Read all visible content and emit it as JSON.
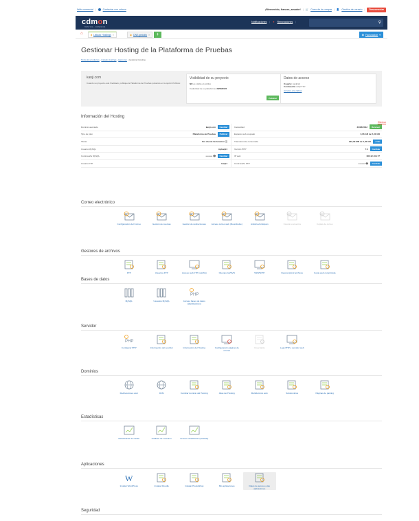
{
  "topbar": {
    "left": [
      "Web comercial",
      "Contactar con cdmon"
    ],
    "greeting": "¡Bienvenido, frances_amador!",
    "cart": "Carro de la compra",
    "user": "Gestión de usuario",
    "logout": "Desconectar"
  },
  "header": {
    "logo": "cdmon",
    "logo_sub": "HOSTING · DOMINIOS",
    "links": [
      "Notificaciones",
      "Renovaciones"
    ]
  },
  "tabs": [
    {
      "label": "Listado Hostings",
      "icon": "chart-icon"
    },
    {
      "label": "DNS gratuito",
      "icon": "dns-icon"
    }
  ],
  "billing": "Facturación",
  "page": {
    "title": "Gestionar Hosting de la Plataforma de Pruebas",
    "breadcrumb": [
      "Todos los productos",
      "Listado Hostings",
      "kanji.com",
      "Gestionar Hosting"
    ]
  },
  "cards": {
    "domain": {
      "title": "kanji.com",
      "text": "Cuando su proyecto esté finalizado, publique la Plataforma de Pruebas pulsando en la opción Publicar."
    },
    "visibility": {
      "title": "Visibilidad de su proyecto",
      "line1_bold": "NO",
      "line1": "es visible al público",
      "line2": "Caducidad de su plataforma:",
      "line2_date": "30/08/2022",
      "button": "Publicar"
    },
    "access": {
      "title": "Datos de acceso",
      "user_label": "Usuario:",
      "user": "kanjiris4",
      "pass_label": "Contraseña:",
      "pass": "A2yl7YKY",
      "link": "Acceder a la cabina"
    }
  },
  "hosting_info": {
    "title": "Información del Hosting",
    "delete": "Eliminar",
    "left": [
      {
        "label": "Dominio asociado",
        "value": "kanji.com",
        "button": "Cambiar"
      },
      {
        "label": "Tipo de plan",
        "value": "Plataforma de Pruebas",
        "button": "Publicar"
      },
      {
        "label": "Titular",
        "value": "Sin cliente facturación ⓘ",
        "button": ""
      },
      {
        "label": "Usuario MySQL",
        "value": "mykanji4",
        "button": ""
      },
      {
        "label": "Contraseña MySQL",
        "value": "•••••••••  👁",
        "button": "Cambiar"
      },
      {
        "label": "Usuario FTP",
        "value": "kanji4",
        "button": ""
      }
    ],
    "right": [
      {
        "label": "Caducidad",
        "value": "30/08/2022",
        "button": "Renovar"
      },
      {
        "label": "Espacio web ocupado",
        "value": "0,06 GB de 5,00 GB",
        "button": ""
      },
      {
        "label": "Transferencia consumida",
        "value": "293,09 MB de 5,00 GB",
        "button": "+ Info"
      },
      {
        "label": "Versión PHP",
        "value": "7.4",
        "button": "Cambiar"
      },
      {
        "label": "IP web",
        "value": "185.42.104.77",
        "button": ""
      },
      {
        "label": "Contraseña FTP",
        "value": "•••••••••  👁",
        "button": "Cambiar"
      }
    ]
  },
  "sections": [
    {
      "title": "Correo electrónico",
      "items": [
        {
          "label": "Configuración del Correo",
          "icon": "mail-gear-icon",
          "enabled": true
        },
        {
          "label": "Gestión de cuentas",
          "icon": "mail-accounts-icon",
          "enabled": true
        },
        {
          "label": "Gestión de redirecciones",
          "icon": "mail-redirect-icon",
          "enabled": true
        },
        {
          "label": "Acceso correo web (Roundcube)",
          "icon": "webmail-icon",
          "enabled": true
        },
        {
          "label": "Antivirus/Antispam",
          "icon": "mail-shield-icon",
          "enabled": true
        },
        {
          "label": "Usuario encuentra",
          "icon": "mail-user-icon",
          "enabled": false
        },
        {
          "label": "Copias de correo",
          "icon": "mail-copy-icon",
          "enabled": false
        }
      ]
    },
    {
      "title": "Gestores de archivos",
      "items": [
        {
          "label": "FTP",
          "icon": "ftp-icon",
          "enabled": true
        },
        {
          "label": "Usuarios FTP",
          "icon": "ftp-users-icon",
          "enabled": true
        },
        {
          "label": "Acceso web FTP (net2ftp)",
          "icon": "web-ftp-icon",
          "enabled": true
        },
        {
          "label": "Clientes Git/SVN",
          "icon": "git-icon",
          "enabled": true
        },
        {
          "label": "SSH/SFTP",
          "icon": "terminal-icon",
          "enabled": true
        },
        {
          "label": "Descomprimir archivos",
          "icon": "unzip-icon",
          "enabled": true
        },
        {
          "label": "Copia web comprimida",
          "icon": "archive-icon",
          "enabled": true
        }
      ]
    },
    {
      "title": "Bases de datos",
      "items": [
        {
          "label": "MySQL",
          "icon": "database-icon",
          "enabled": true
        },
        {
          "label": "Usuarios MySQL",
          "icon": "db-users-icon",
          "enabled": true
        },
        {
          "label": "Acceso bases de datos (phpMyAdmin)",
          "icon": "phpmyadmin-icon",
          "enabled": true
        }
      ]
    },
    {
      "title": "Servidor",
      "items": [
        {
          "label": "Configurar PHP",
          "icon": "php-gear-icon",
          "enabled": true
        },
        {
          "label": "Información del servidor",
          "icon": "server-info-icon",
          "enabled": true
        },
        {
          "label": "Información del Hosting",
          "icon": "hosting-info-icon",
          "enabled": true
        },
        {
          "label": "Configuración páginas de errores",
          "icon": "error-page-icon",
          "enabled": true
        },
        {
          "label": "Crear tabla",
          "icon": "cron-icon",
          "enabled": false
        },
        {
          "label": "Logs PHP y servidor web",
          "icon": "logs-icon",
          "enabled": true
        }
      ]
    },
    {
      "title": "Dominios",
      "items": [
        {
          "label": "Redirecciones web",
          "icon": "redirect-icon",
          "enabled": true
        },
        {
          "label": "DNS",
          "icon": "dns-globe-icon",
          "enabled": true
        },
        {
          "label": "Cambiar dominio del Hosting",
          "icon": "change-domain-icon",
          "enabled": true
        },
        {
          "label": "Alias del Hosting",
          "icon": "alias-icon",
          "enabled": true
        },
        {
          "label": "Multidominio web",
          "icon": "multidomain-icon",
          "enabled": true
        },
        {
          "label": "Subdominios",
          "icon": "subdomain-icon",
          "enabled": true
        },
        {
          "label": "Páginas de parking",
          "icon": "parking-icon",
          "enabled": true
        }
      ]
    },
    {
      "title": "Estadísticas",
      "items": [
        {
          "label": "Estadísticas de visitas",
          "icon": "stats-icon",
          "enabled": true
        },
        {
          "label": "Gráficas de consumo",
          "icon": "pie-chart-icon",
          "enabled": true
        },
        {
          "label": "Acceso estadísticas (Awstats)",
          "icon": "awstats-icon",
          "enabled": true
        }
      ]
    },
    {
      "title": "Aplicaciones",
      "items": [
        {
          "label": "Instalar WordPress",
          "icon": "wordpress-icon",
          "enabled": true
        },
        {
          "label": "Instalar Moodle",
          "icon": "moodle-icon",
          "enabled": true
        },
        {
          "label": "Instalar PrestaShop",
          "icon": "prestashop-icon",
          "enabled": true
        },
        {
          "label": "Mis aplicaciones",
          "icon": "apps-icon",
          "enabled": true
        },
        {
          "label": "Datos de acceso a las aplicaciones",
          "icon": "apps-access-icon",
          "enabled": true,
          "highlighted": true
        }
      ]
    },
    {
      "title": "Seguridad",
      "items": []
    }
  ]
}
